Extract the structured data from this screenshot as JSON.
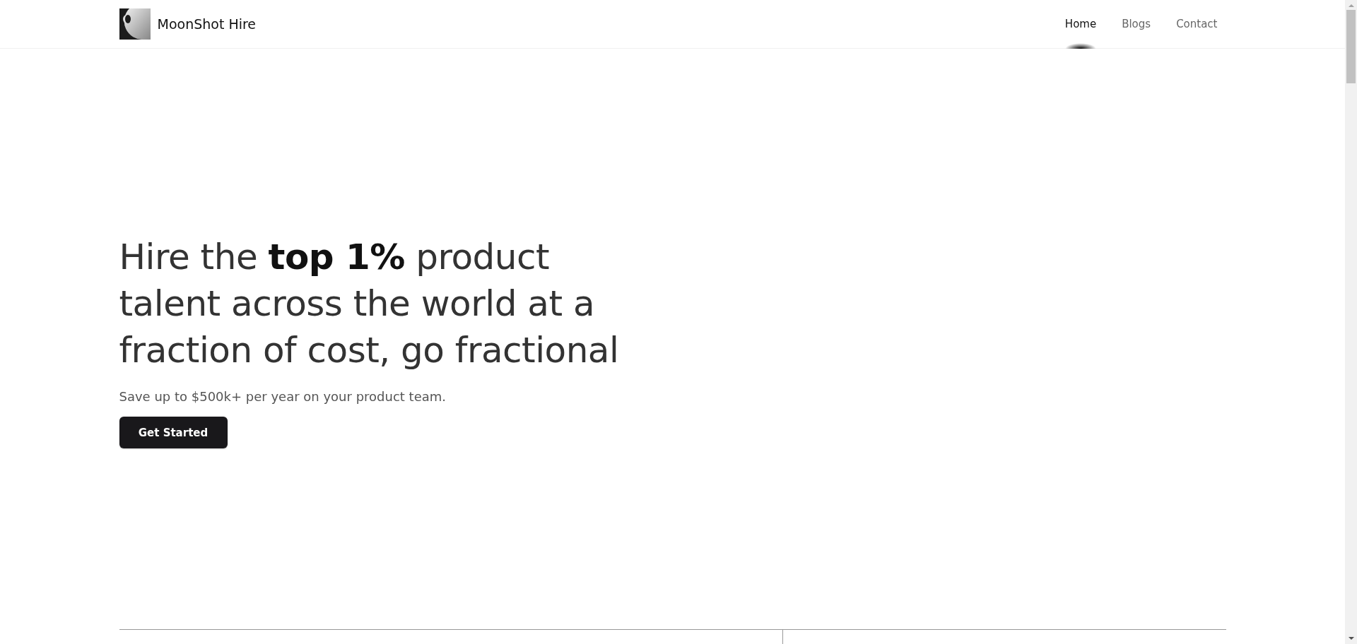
{
  "header": {
    "brand": "MoonShot Hire",
    "nav": [
      {
        "label": "Home",
        "selected": true
      },
      {
        "label": "Blogs",
        "selected": false
      },
      {
        "label": "Contact",
        "selected": false
      }
    ]
  },
  "hero": {
    "headline": "Hire the **top 1%** product talent across the world at a fraction of cost, go fractional",
    "subtitle": "Save up to $500k+ per year on your product team.",
    "cta": "Get Started"
  }
}
